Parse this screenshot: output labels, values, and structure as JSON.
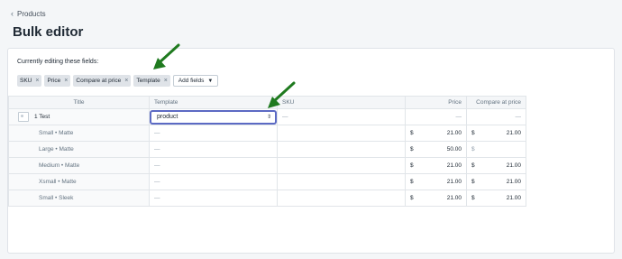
{
  "breadcrumb": {
    "label": "Products"
  },
  "page": {
    "title": "Bulk editor"
  },
  "editor": {
    "editing_label": "Currently editing these fields:",
    "fields": [
      {
        "label": "SKU"
      },
      {
        "label": "Price"
      },
      {
        "label": "Compare at price"
      },
      {
        "label": "Template"
      }
    ],
    "add_fields_label": "Add fields",
    "remove_glyph": "×"
  },
  "table": {
    "headers": {
      "title": "Title",
      "template": "Template",
      "sku": "SKU",
      "price": "Price",
      "compare": "Compare at price"
    },
    "product": {
      "title": "1 Test",
      "template_value": "product",
      "sku": "—",
      "price": "—",
      "compare": "—"
    },
    "variants": [
      {
        "title": "Small • Matte",
        "template": "—",
        "currency": "$",
        "price": "21.00",
        "compare_currency": "$",
        "compare": "21.00"
      },
      {
        "title": "Large • Matte",
        "template": "—",
        "currency": "$",
        "price": "50.00",
        "compare_currency": "$",
        "compare": ""
      },
      {
        "title": "Medium • Matte",
        "template": "—",
        "currency": "$",
        "price": "21.00",
        "compare_currency": "$",
        "compare": "21.00"
      },
      {
        "title": "Xsmall • Matte",
        "template": "—",
        "currency": "$",
        "price": "21.00",
        "compare_currency": "$",
        "compare": "21.00"
      },
      {
        "title": "Small • Sleek",
        "template": "—",
        "currency": "$",
        "price": "21.00",
        "compare_currency": "$",
        "compare": "21.00"
      }
    ]
  },
  "colors": {
    "accent": "#5c6ac4",
    "annotation_arrow": "#1f7a1f"
  }
}
